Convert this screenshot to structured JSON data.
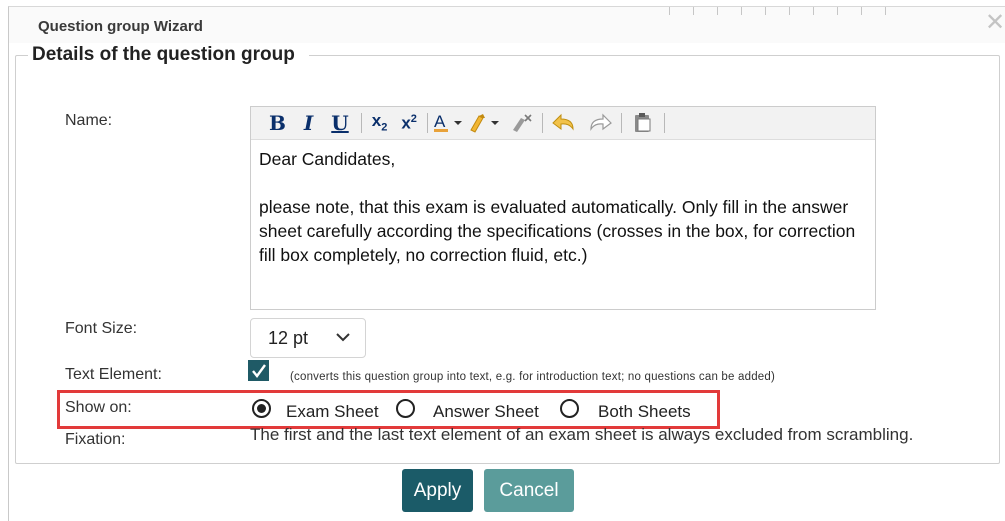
{
  "dialog": {
    "title": "Question group Wizard"
  },
  "section": {
    "legend": "Details of the question group"
  },
  "fields": {
    "name_label": "Name:",
    "font_size_label": "Font Size:",
    "text_element_label": "Text Element:",
    "show_on_label": "Show on:",
    "fixation_label": "Fixation:"
  },
  "editor": {
    "toolbar": {
      "bold": "B",
      "italic": "I",
      "underline": "U",
      "subscript_base": "x",
      "subscript_mark": "2",
      "superscript_base": "x",
      "superscript_mark": "2"
    },
    "content": "Dear Candidates,\n\nplease note, that this exam is evaluated automatically. Only fill in the answer sheet carefully according the specifications (crosses in the box, for correction fill box completely, no correction fluid, etc.)"
  },
  "font_size": {
    "selected": "12 pt"
  },
  "text_element": {
    "checked": true,
    "hint": "(converts this question group into text, e.g. for introduction text; no questions can be added)"
  },
  "show_on": {
    "options": [
      {
        "label": "Exam Sheet",
        "selected": true
      },
      {
        "label": "Answer Sheet",
        "selected": false
      },
      {
        "label": "Both Sheets",
        "selected": false
      }
    ]
  },
  "fixation": {
    "text": "The first and the last text element of an exam sheet is always excluded from scrambling."
  },
  "buttons": {
    "apply": "Apply",
    "cancel": "Cancel"
  },
  "colors": {
    "primary_button": "#1b5b68",
    "secondary_button": "#5b9c9b",
    "highlight": "#e23a3a",
    "icon_blue": "#0a2f6b"
  }
}
